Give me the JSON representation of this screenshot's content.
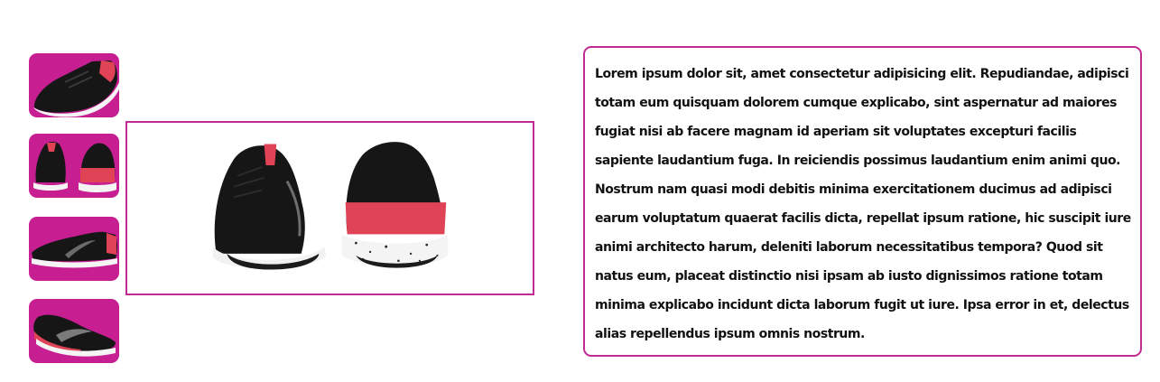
{
  "colors": {
    "accent": "#c71e92",
    "border": "#c02a92",
    "shoe_body": "#161616",
    "shoe_heel": "#e04356",
    "sole": "#f4f4f4"
  },
  "gallery": {
    "thumbnails": [
      {
        "icon": "shoe-side-view-icon"
      },
      {
        "icon": "shoe-front-back-view-icon"
      },
      {
        "icon": "shoe-lateral-view-icon"
      },
      {
        "icon": "shoe-angled-view-icon"
      }
    ],
    "main_image": {
      "icon": "shoe-front-back-view-icon"
    }
  },
  "description": {
    "text": "Lorem ipsum dolor sit, amet consectetur adipisicing elit. Repudiandae, adipisci totam eum quisquam dolorem cumque explicabo, sint aspernatur ad maiores fugiat nisi ab facere magnam id aperiam sit voluptates excepturi facilis sapiente laudantium fuga. In reiciendis possimus laudantium enim animi quo. Nostrum nam quasi modi debitis minima exercitationem ducimus ad adipisci earum voluptatum quaerat facilis dicta, repellat ipsum ratione, hic suscipit iure animi architecto harum, deleniti laborum necessitatibus tempora? Quod sit natus eum, placeat distinctio nisi ipsam ab iusto dignissimos ratione totam minima explicabo incidunt dicta laborum fugit ut iure. Ipsa error in et, delectus alias repellendus ipsum omnis nostrum."
  }
}
